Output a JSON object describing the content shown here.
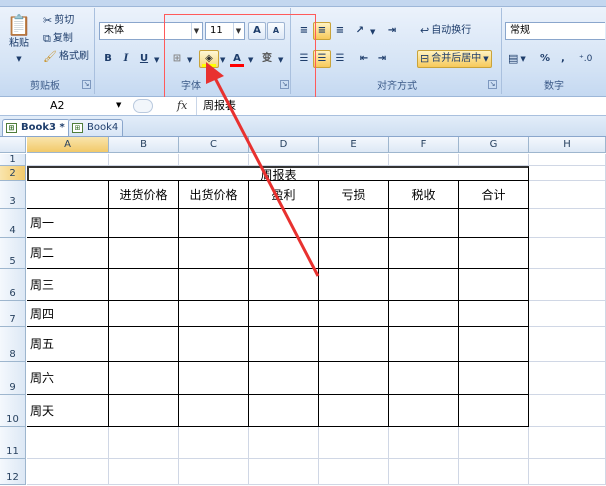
{
  "clipboard": {
    "paste_label": "粘贴",
    "cut_label": "剪切",
    "copy_label": "复制",
    "format_painter_label": "格式刷",
    "group_label": "剪贴板"
  },
  "font": {
    "font_name": "宋体",
    "font_size": "11",
    "grow_label": "A",
    "shrink_label": "A",
    "bold_label": "B",
    "italic_label": "I",
    "underline_label": "U",
    "font_color_label": "A",
    "phonetic_label": "变",
    "group_label": "字体"
  },
  "alignment": {
    "wrap_label": "自动换行",
    "merge_label": "合并后居中",
    "group_label": "对齐方式"
  },
  "number": {
    "format": "常规",
    "percent_label": "%",
    "comma_label": ",",
    "group_label": "数字"
  },
  "formula_bar": {
    "name_box": "A2",
    "fx_label": "fx",
    "content": "周报表"
  },
  "sheet_tabs": [
    {
      "label": "Book3 *"
    },
    {
      "label": "Book4"
    }
  ],
  "columns": [
    "A",
    "B",
    "C",
    "D",
    "E",
    "F",
    "G",
    "H"
  ],
  "rows": [
    "1",
    "2",
    "3",
    "4",
    "5",
    "6",
    "7",
    "8",
    "9",
    "10",
    "11",
    "12"
  ],
  "table": {
    "title": "周报表",
    "headers": [
      "进货价格",
      "出货价格",
      "盈利",
      "亏损",
      "税收",
      "合计"
    ],
    "days": [
      "周一",
      "周二",
      "周三",
      "周四",
      "周五",
      "周六",
      "周天"
    ]
  },
  "colors": {
    "highlight_box": "#ff5a5a",
    "arrow": "#e8312f",
    "selected_header": "#f7d98d"
  }
}
